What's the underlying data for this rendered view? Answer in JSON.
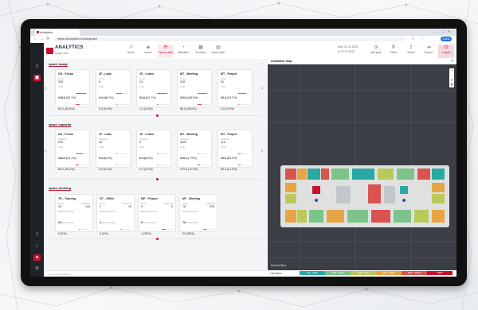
{
  "browser": {
    "tab_title": "Analytics",
    "url": "https://analytics.cloud/space",
    "profile_label": "Guest"
  },
  "app": {
    "logo_text": "ANALYTICS",
    "logo_sub": "space data",
    "nav": [
      {
        "label": "report",
        "icon": "chart-icon"
      },
      {
        "label": "space",
        "icon": "layers-icon"
      },
      {
        "label": "space data",
        "icon": "refresh-icon",
        "active": true
      },
      {
        "label": "utilization",
        "icon": "gauge-icon"
      },
      {
        "label": "booking",
        "icon": "calendar-icon"
      },
      {
        "label": "space plan",
        "icon": "grid-icon"
      }
    ],
    "date_from_label": "from",
    "date_from": "01.01.2023",
    "date_to_label": "to",
    "date_to": "31.12.2023",
    "actions": [
      {
        "label": "last year",
        "icon": "history-icon"
      },
      {
        "label": "Filter",
        "icon": "filter-icon"
      },
      {
        "label": "Share",
        "icon": "share-icon",
        "red": true
      },
      {
        "label": "Export",
        "icon": "export-icon"
      },
      {
        "label": "Logout",
        "icon": "logout-icon",
        "red": true,
        "filled": true
      }
    ]
  },
  "colors": {
    "brand": "#c8102e",
    "green": "#3aa66b",
    "red": "#d9534f",
    "teal": "#2aa9a4"
  },
  "sections": {
    "usage": {
      "title": "space usage",
      "cards": [
        {
          "title": "OS - Focus",
          "l1": "Level",
          "v1": "200",
          "l2": "Total",
          "v2": "138.6 (90.1%)",
          "l3": "Booked",
          "v3": "69.2 (34.5%)",
          "p2": 0.9,
          "p3": 0.35
        },
        {
          "title": "1F - Labs",
          "l1": "Level",
          "v1": "8",
          "l2": "Total",
          "v2": "4.0 (48.7%)",
          "l3": "Booked",
          "v3": "0.0 (0.0%)",
          "p2": 0.49,
          "p3": 0.02
        },
        {
          "title": "1F - Lobes",
          "l1": "Level",
          "v1": "24",
          "l2": "Total",
          "v2": "32.6 (91.7%)",
          "l3": "Booked",
          "v3": "2.0 (8.3%)",
          "p2": 0.92,
          "p3": 0.08
        },
        {
          "title": "MT - Meeting",
          "l1": "Level",
          "v1": "228",
          "l2": "Total",
          "v2": "190.4 (83.5%)",
          "l3": "Booked",
          "v3": "88.0 (38.6%)",
          "p2": 0.84,
          "p3": 0.39
        },
        {
          "title": "MT - Project",
          "l1": "Level",
          "v1": "31",
          "l2": "Total",
          "v2": "23.0 (74.2%)",
          "l3": "Booked",
          "v3": "0.0 (0.0%)",
          "p2": 0.74,
          "p3": 0.02
        }
      ]
    },
    "capacity": {
      "title": "space capacity",
      "cards": [
        {
          "title": "OS - Focus",
          "l1": "Capacity",
          "v1": "229",
          "l2": "Total",
          "v2": "140.0 (61.1%)",
          "l3": "Booked",
          "v3": "69.2 (30.2%)",
          "p2": 0.61,
          "p3": 0.3
        },
        {
          "title": "1F - Labs",
          "l1": "Capacity",
          "v1": "16",
          "l2": "Total",
          "v2": "0.0 (0.0%)",
          "l3": "Booked",
          "v3": "0.0 (0.0%)",
          "p2": 0.02,
          "p3": 0.02
        },
        {
          "title": "1F - Lobes",
          "l1": "Capacity",
          "v1": "0",
          "l2": "Total",
          "v2": "0.0 (0.0%)",
          "l3": "Booked",
          "v3": "0.0 (0.0%)",
          "p2": 0.02,
          "p3": 0.02
        },
        {
          "title": "MT - Meeting",
          "l1": "Capacity",
          "v1": "1520",
          "l2": "Total",
          "v2": "120.1 (7.9%)",
          "l3": "Booked",
          "v3": "279.4 (17.5%)",
          "p2": 0.08,
          "p3": 0.18
        },
        {
          "title": "MT - Project",
          "l1": "Capacity",
          "v1": "115",
          "l2": "Total",
          "v2": "23.0 (20.0%)",
          "l3": "Booked",
          "v3": "50.0 (21.5%)",
          "p2": 0.2,
          "p3": 0.22
        }
      ]
    },
    "booking": {
      "title": "space booking",
      "cards": [
        {
          "title": "TR - Training",
          "l1": "Level",
          "v1": "10",
          "l1b": "Capacity",
          "v1b": "144",
          "l2": "Booked (rooms)",
          "v2": "10",
          "l3": "Booked (hours)",
          "v3": "0 (0%)",
          "p3": 0.02
        },
        {
          "title": "OT - Office",
          "l1": "Level",
          "v1": "1",
          "l1b": "Capacity",
          "v1b": "10",
          "l2": "Booked (rooms)",
          "v2": "1",
          "l3": "Booked (hours)",
          "v3": "0 (0%)",
          "p3": 0.02
        },
        {
          "title": "MP - Project",
          "l1": "Level",
          "v1": "0",
          "l1b": "Capacity",
          "v1b": "0",
          "l2": "Booked (rooms)",
          "v2": "0",
          "l3": "Booked (hours)",
          "v3": "1 (33%)",
          "p3": 0.33
        },
        {
          "title": "MT - Meeting",
          "l1": "Level",
          "v1": "76",
          "l1b": "Capacity",
          "v1b": "678",
          "l2": "Booked (rooms)",
          "v2": "76",
          "l3": "Booked (hours)",
          "v3": "21 (28%)",
          "p3": 0.28
        }
      ]
    }
  },
  "map": {
    "title": "utilization map",
    "floor_label": "Ground floor",
    "legend_label": "Utilization",
    "legend": [
      {
        "label": "0% - 20%",
        "color": "#2aa9a4"
      },
      {
        "label": "20% - 40%",
        "color": "#7cc48a"
      },
      {
        "label": "40% - 60%",
        "color": "#b9c95a"
      },
      {
        "label": "60% - 80%",
        "color": "#e8a545"
      },
      {
        "label": "80% - 100%",
        "color": "#d9534f"
      },
      {
        "label": "100%",
        "color": "#c8102e"
      }
    ]
  },
  "footer": {
    "text": "powered by analytics"
  }
}
